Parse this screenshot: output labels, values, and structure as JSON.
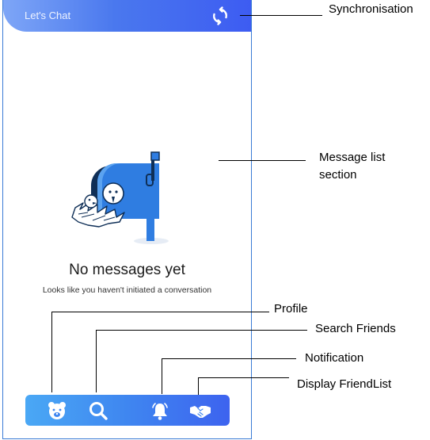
{
  "app": {
    "title": "Let's Chat"
  },
  "icons": {
    "sync": "sync-icon",
    "illustration": "mailbox-birds-illustration",
    "profile": "bear-face-icon",
    "search": "search-icon",
    "notification": "bell-icon",
    "friendlist": "handshake-icon"
  },
  "empty_state": {
    "title": "No messages yet",
    "subtitle": "Looks like you haven't initiated a conversation"
  },
  "annotations": {
    "sync": "Synchronisation",
    "message_list": "Message list section",
    "profile": "Profile",
    "search": "Search Friends",
    "notification": "Notification",
    "friendlist": "Display FriendList"
  },
  "colors": {
    "appbar_start": "#7ea6f7",
    "appbar_end": "#3d5cf2",
    "nav_start": "#4aa8f5",
    "nav_end": "#3d63ef",
    "mailbox": "#2f7de1",
    "dark_navy": "#0f2f57"
  }
}
